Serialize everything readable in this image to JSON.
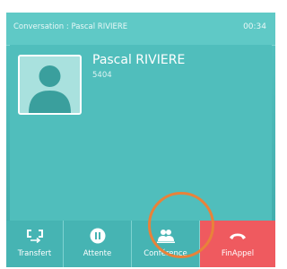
{
  "titlebar": {
    "title": "Conversation : Pascal RIVIERE",
    "timer": "00:34"
  },
  "contact": {
    "name": "Pascal RIVIERE",
    "number": "5404",
    "avatar_icon": "person-silhouette-icon"
  },
  "softkeys": [
    {
      "label": "Transfert",
      "icon": "transfer-icon"
    },
    {
      "label": "Attente",
      "icon": "pause-icon"
    },
    {
      "label": "Conférence",
      "icon": "conference-icon"
    },
    {
      "label": "FinAppel",
      "icon": "hang-up-icon"
    }
  ],
  "colors": {
    "screen_teal": "#4ab7b6",
    "end_call_red": "#ef5a5f",
    "highlight_ring": "#e8823a"
  }
}
